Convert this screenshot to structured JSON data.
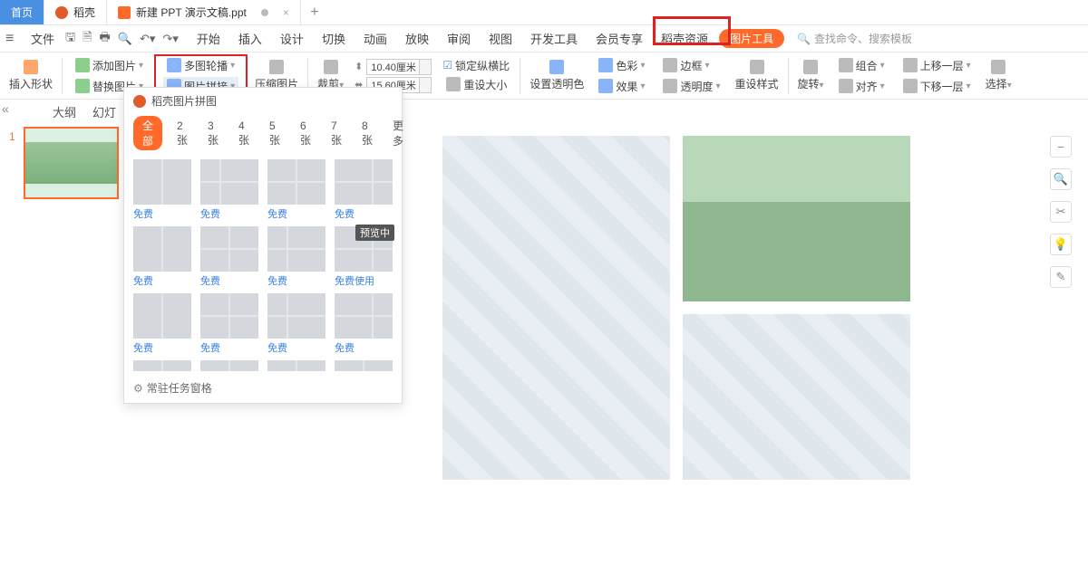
{
  "titlebar": {
    "home": "首页",
    "doc_tab": "稻壳",
    "ppt_tab": "新建 PPT 演示文稿.ppt"
  },
  "qat": {
    "file": "文件"
  },
  "menu": {
    "items": [
      "开始",
      "插入",
      "设计",
      "切换",
      "动画",
      "放映",
      "审阅",
      "视图",
      "开发工具",
      "会员专享",
      "稻壳资源"
    ],
    "pill": "图片工具",
    "search_placeholder": "查找命令、搜索模板"
  },
  "ribbon": {
    "insert_shape": "插入形状",
    "add_pic": "添加图片",
    "replace_pic": "替换图片",
    "multi_slideshow": "多图轮播",
    "pic_join": "图片拼接",
    "compress": "压缩图片",
    "crop": "裁剪",
    "w_val": "10.40厘米",
    "h_val": "15.60厘米",
    "lock_ratio": "锁定纵横比",
    "reset_size": "重设大小",
    "set_trans": "设置透明色",
    "color": "色彩",
    "effects": "效果",
    "border": "边框",
    "trans": "透明度",
    "reset_style": "重设样式",
    "rotate": "旋转",
    "combine": "组合",
    "align": "对齐",
    "up_layer": "上移一层",
    "down_layer": "下移一层",
    "select": "选择"
  },
  "outline": {
    "tab1": "大纲",
    "tab2": "幻灯"
  },
  "drop": {
    "title": "稻壳图片拼图",
    "tabs": [
      "全部",
      "2张",
      "3张",
      "4张",
      "5张",
      "6张",
      "7张",
      "8张",
      "更多"
    ],
    "free": "免费",
    "free_use": "免费使用",
    "preview": "预览中",
    "footer": "常驻任务窗格"
  },
  "slide_number": "1"
}
